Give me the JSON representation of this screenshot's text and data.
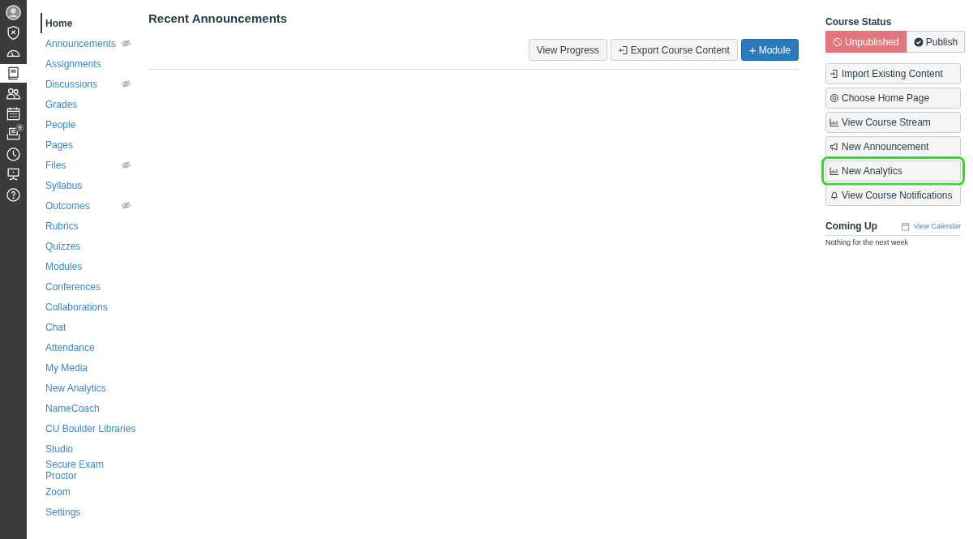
{
  "global_nav": [
    {
      "kind": "avatar",
      "selected": false
    },
    {
      "kind": "shield",
      "selected": false
    },
    {
      "kind": "dashboard",
      "selected": false
    },
    {
      "kind": "courses",
      "selected": true
    },
    {
      "kind": "groups",
      "selected": false
    },
    {
      "kind": "calendar",
      "selected": false
    },
    {
      "kind": "inbox",
      "selected": false,
      "badge": "9"
    },
    {
      "kind": "history",
      "selected": false
    },
    {
      "kind": "commons",
      "selected": false
    },
    {
      "kind": "help",
      "selected": false
    }
  ],
  "course_nav": [
    {
      "label": "Home",
      "selected": true,
      "hidden": false
    },
    {
      "label": "Announcements",
      "selected": false,
      "hidden": true
    },
    {
      "label": "Assignments",
      "selected": false,
      "hidden": false
    },
    {
      "label": "Discussions",
      "selected": false,
      "hidden": true
    },
    {
      "label": "Grades",
      "selected": false,
      "hidden": false
    },
    {
      "label": "People",
      "selected": false,
      "hidden": false
    },
    {
      "label": "Pages",
      "selected": false,
      "hidden": false
    },
    {
      "label": "Files",
      "selected": false,
      "hidden": true
    },
    {
      "label": "Syllabus",
      "selected": false,
      "hidden": false
    },
    {
      "label": "Outcomes",
      "selected": false,
      "hidden": true
    },
    {
      "label": "Rubrics",
      "selected": false,
      "hidden": false
    },
    {
      "label": "Quizzes",
      "selected": false,
      "hidden": false
    },
    {
      "label": "Modules",
      "selected": false,
      "hidden": false
    },
    {
      "label": "Conferences",
      "selected": false,
      "hidden": false
    },
    {
      "label": "Collaborations",
      "selected": false,
      "hidden": false
    },
    {
      "label": "Chat",
      "selected": false,
      "hidden": false
    },
    {
      "label": "Attendance",
      "selected": false,
      "hidden": false
    },
    {
      "label": "My Media",
      "selected": false,
      "hidden": false
    },
    {
      "label": "New Analytics",
      "selected": false,
      "hidden": false
    },
    {
      "label": "NameCoach",
      "selected": false,
      "hidden": false
    },
    {
      "label": "CU Boulder Libraries",
      "selected": false,
      "hidden": false
    },
    {
      "label": "Studio",
      "selected": false,
      "hidden": false
    },
    {
      "label": "Secure Exam\nProctor",
      "selected": false,
      "hidden": false
    },
    {
      "label": "Zoom",
      "selected": false,
      "hidden": false
    },
    {
      "label": "Settings",
      "selected": false,
      "hidden": false
    }
  ],
  "main": {
    "title": "Recent Announcements",
    "buttons": [
      {
        "label": "View Progress",
        "kind": "plain"
      },
      {
        "label": "Export Course Content",
        "kind": "export"
      },
      {
        "label": "Module",
        "kind": "primary",
        "icon_text": "+"
      }
    ]
  },
  "sidebar": {
    "status_title": "Course Status",
    "status": [
      {
        "label": "Unpublished",
        "kind": "unpublished",
        "selected": true
      },
      {
        "label": "Publish",
        "kind": "publish",
        "selected": false
      }
    ],
    "actions": [
      {
        "label": "Import Existing Content",
        "kind": "import",
        "highlighted": false
      },
      {
        "label": "Choose Home Page",
        "kind": "target",
        "highlighted": false
      },
      {
        "label": "View Course Stream",
        "kind": "chart",
        "highlighted": false
      },
      {
        "label": "New Announcement",
        "kind": "megaphone",
        "highlighted": false
      },
      {
        "label": "New Analytics",
        "kind": "chart",
        "highlighted": true
      },
      {
        "label": "View Course Notifications",
        "kind": "bell",
        "highlighted": false
      }
    ],
    "coming_up": {
      "title": "Coming Up",
      "link": "View Calendar",
      "empty": "Nothing for the next week"
    }
  }
}
